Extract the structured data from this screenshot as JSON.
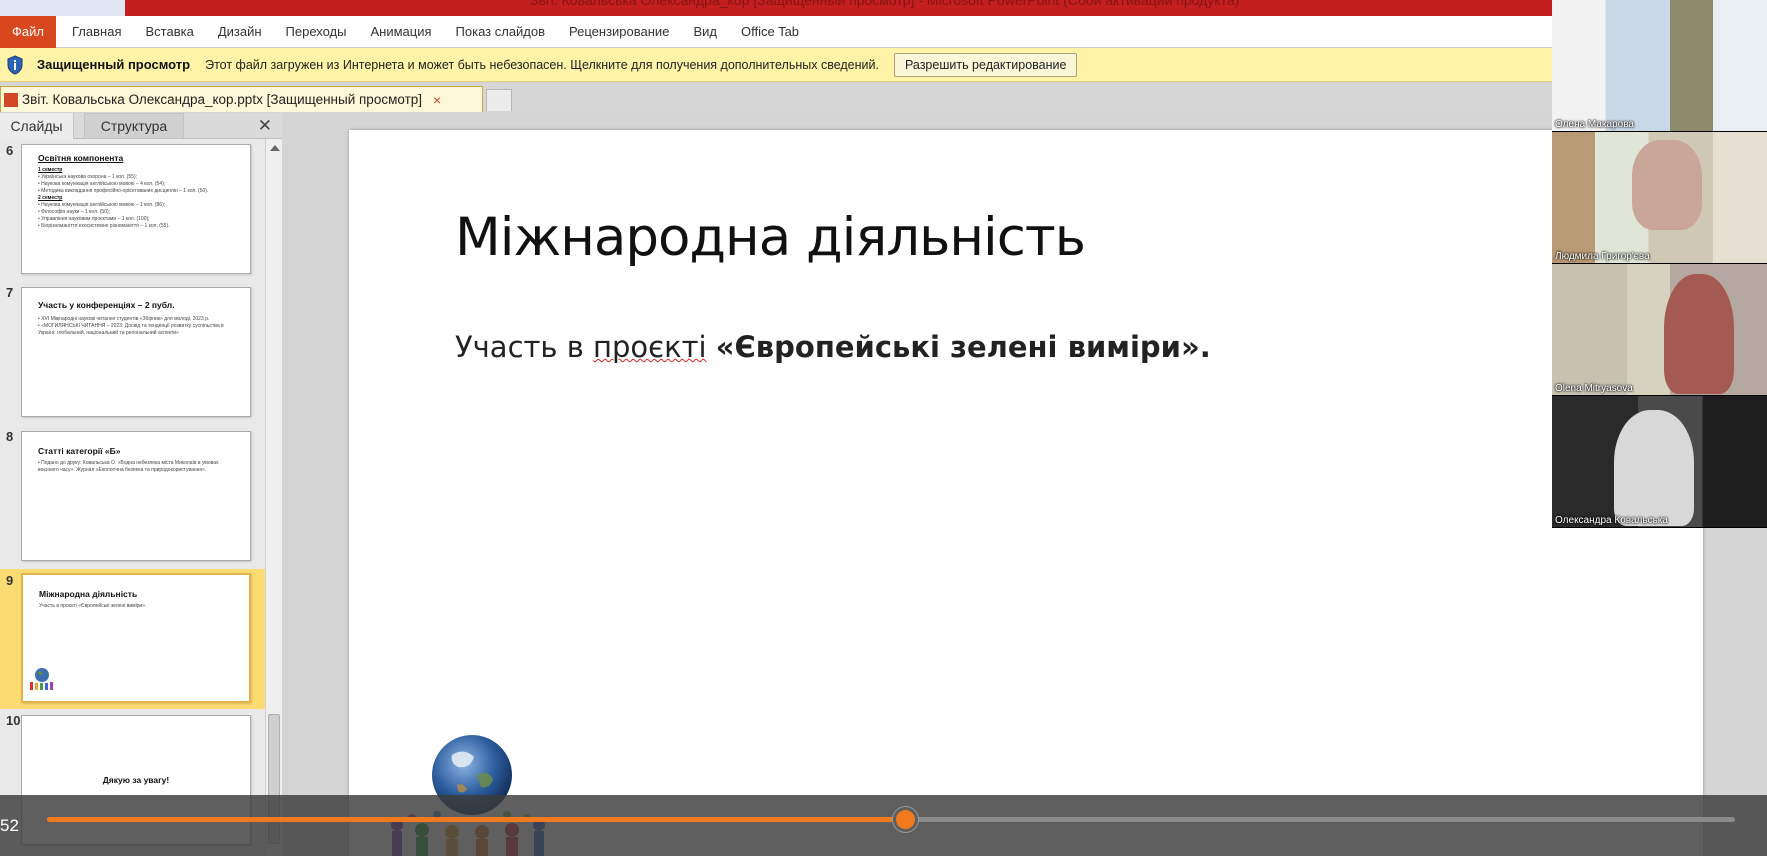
{
  "window": {
    "title": "Звіт. Ковальська Олександра_кор [Защищенный просмотр] - Microsoft PowerPoint (Сбой активации продукта)"
  },
  "ribbon": {
    "file_tab": "Файл",
    "tabs": [
      "Главная",
      "Вставка",
      "Дизайн",
      "Переходы",
      "Анимация",
      "Показ слайдов",
      "Рецензирование",
      "Вид",
      "Office Tab"
    ]
  },
  "protected_view": {
    "title": "Защищенный просмотр",
    "message": "Этот файл загружен из Интернета и может быть небезопасен. Щелкните для получения дополнительных сведений.",
    "button": "Разрешить редактирование"
  },
  "document_tab": {
    "name": "Звіт. Ковальська Олександра_кор.pptx [Защищенный просмотр]",
    "close": "×"
  },
  "slides_pane": {
    "tabs": [
      "Слайды",
      "Структура"
    ],
    "close": "✕",
    "thumbnails": [
      {
        "number": "6",
        "title": "Освітня компонента",
        "lines": [
          "1 семестр",
          "• Українська наукова охорона – 1 кол. (55);",
          "• Наукова комунікація англійською мовою – 4 кол. (54);",
          "• Методика викладання професійно-орієнтованих дисциплін – 1 кол. (50).",
          "2 семестр",
          "• Наукова комунікація англійською мовою – 1 кол. (86);",
          "• Філософія науки – 1 кол. (50);",
          "• Управління науковим проєктами – 1 кол. (100);",
          "• Біорізноманіття екосистемне різноманіття – 1 кол. (55)."
        ]
      },
      {
        "number": "7",
        "title": "Участь у конференціях – 2 публ.",
        "lines": [
          "• XVI Міжнародні наукові читання студентів «Збірник» для молоді, 2023 р.",
          "• «МОГИЛЯНСЬКІ ЧИТАННЯ – 2023: Досвід та тенденції розвитку суспільства в Україні: глобальний, національний та регіональний аспекти»"
        ]
      },
      {
        "number": "8",
        "title": "Статті категорії «Б»",
        "lines": [
          "• Подано до друку: Ковальська О. «Водна небезпека міста Миколаїв в умовах воєнного часу». Журнал «Екологічна безпека та природокористування»."
        ]
      },
      {
        "number": "9",
        "title": "Міжнародна діяльність",
        "lines": [
          "Участь в проєкті «Європейські зелені виміри»."
        ]
      },
      {
        "number": "10",
        "title": "Дякую за увагу!",
        "lines": []
      }
    ]
  },
  "slide": {
    "title": "Міжнародна діяльність",
    "body_prefix": "Участь в ",
    "body_spell": "проєкті",
    "body_bold": "«Європейські зелені виміри»."
  },
  "participants": [
    {
      "name": "Олена Макарова"
    },
    {
      "name": "Людмила Григор'єва"
    },
    {
      "name": "Olena Mitryasova"
    },
    {
      "name": "Олександра Ковальська"
    }
  ],
  "player": {
    "time": "52",
    "progress_fraction": 0.508
  },
  "colors": {
    "file_tab": "#d9471f",
    "protected_bar": "#fff3a8",
    "selected_thumb": "#fbdc72",
    "progress": "#f07a1d"
  }
}
